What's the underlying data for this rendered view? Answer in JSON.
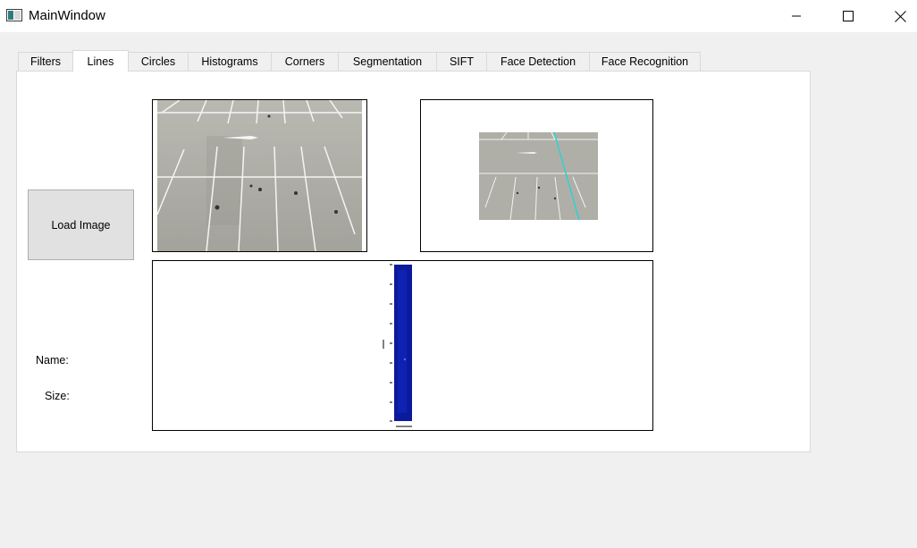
{
  "window": {
    "title": "MainWindow",
    "controls": [
      "minimize-icon",
      "maximize-icon",
      "close-icon"
    ]
  },
  "tabs": [
    {
      "label": "Filters"
    },
    {
      "label": "Lines",
      "active": true
    },
    {
      "label": "Circles"
    },
    {
      "label": "Histograms"
    },
    {
      "label": "Corners"
    },
    {
      "label": "Segmentation"
    },
    {
      "label": "SIFT"
    },
    {
      "label": "Face Detection"
    },
    {
      "label": "Face Recognition"
    }
  ],
  "lines_tab": {
    "load_button_label": "Load Image",
    "name_label": "Name:",
    "size_label": "Size:"
  },
  "colors": {
    "hough_line": "#2fd1d1",
    "accumulator": "#0b1a9c"
  }
}
